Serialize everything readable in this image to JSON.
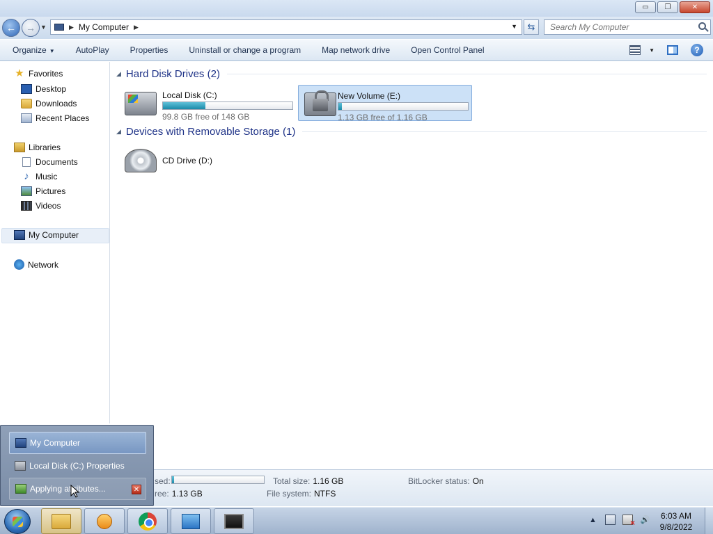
{
  "window": {
    "title_buttons": {
      "minimize": "▭",
      "restore": "❐",
      "close": "✕"
    }
  },
  "address": {
    "path": "My Computer",
    "refresh": "⇆"
  },
  "search": {
    "placeholder": "Search My Computer"
  },
  "toolbar": {
    "items": [
      {
        "label": "Organize",
        "dropdown": true
      },
      {
        "label": "AutoPlay"
      },
      {
        "label": "Properties"
      },
      {
        "label": "Uninstall or change a program"
      },
      {
        "label": "Map network drive"
      },
      {
        "label": "Open Control Panel"
      }
    ],
    "help_label": "?"
  },
  "sidebar": {
    "favorites": "Favorites",
    "desktop": "Desktop",
    "downloads": "Downloads",
    "recent": "Recent Places",
    "libraries": "Libraries",
    "documents": "Documents",
    "music": "Music",
    "pictures": "Pictures",
    "videos": "Videos",
    "computer": "My Computer",
    "network": "Network",
    "icons": {
      "star": "★",
      "note": "♪"
    }
  },
  "groups": {
    "hdd": {
      "title": "Hard Disk Drives (2)"
    },
    "removable": {
      "title": "Devices with Removable Storage (1)"
    }
  },
  "drives": {
    "c": {
      "name": "Local Disk (C:)",
      "free_text": "99.8 GB free of 148 GB",
      "used_fraction": 0.326
    },
    "e": {
      "name": "New Volume (E:)",
      "free_text": "1.13 GB free of 1.16 GB",
      "used_fraction": 0.026
    },
    "d": {
      "name": "CD Drive (D:)"
    }
  },
  "details": {
    "used_label": "sed:",
    "free_label": "ree:",
    "free_value": "1.13 GB",
    "total_label": "Total size:",
    "total_value": "1.16 GB",
    "fs_label": "File system:",
    "fs_value": "NTFS",
    "bitlocker_label": "BitLocker status:",
    "bitlocker_value": "On",
    "used_fraction": 0.026
  },
  "jumplist": {
    "items": [
      {
        "label": "My Computer"
      },
      {
        "label": "Local Disk (C:) Properties"
      },
      {
        "label": "Applying attributes..."
      }
    ],
    "cancel": "✕"
  },
  "clock": {
    "time": "6:03 AM",
    "date": "9/8/2022"
  },
  "tray": {
    "expand": "▲",
    "volume": "🔊"
  }
}
